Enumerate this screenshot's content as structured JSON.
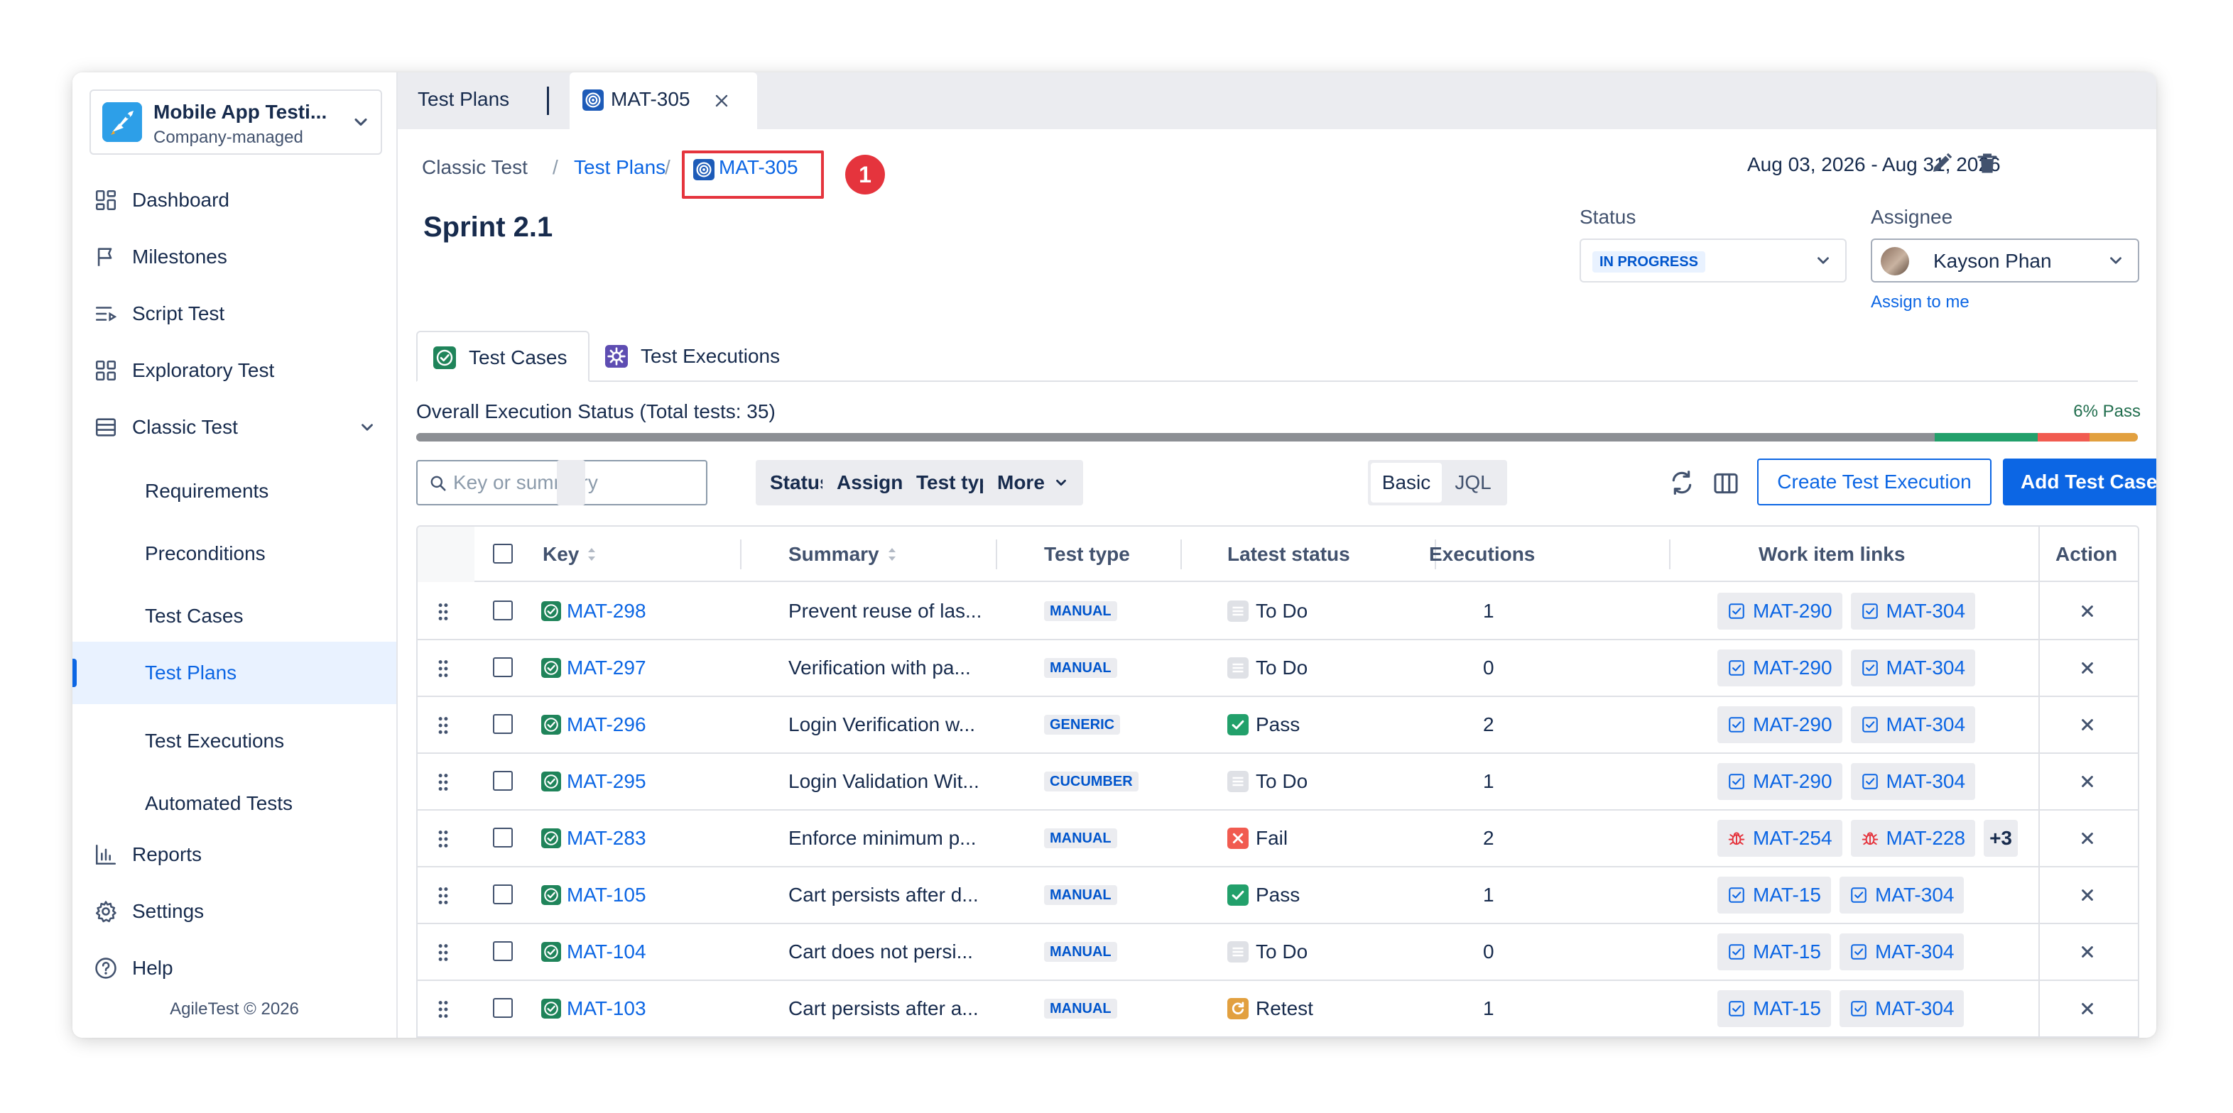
{
  "sidebar": {
    "project_name": "Mobile App Testi...",
    "project_type": "Company-managed",
    "items": [
      {
        "label": "Dashboard",
        "icon": "dashboard-icon"
      },
      {
        "label": "Milestones",
        "icon": "flag-icon"
      },
      {
        "label": "Script Test",
        "icon": "script-list-icon"
      },
      {
        "label": "Exploratory Test",
        "icon": "grid-icon"
      },
      {
        "label": "Classic Test",
        "icon": "table-icon"
      },
      {
        "label": "Requirements"
      },
      {
        "label": "Preconditions"
      },
      {
        "label": "Test Cases"
      },
      {
        "label": "Test Plans",
        "active": true
      },
      {
        "label": "Test Executions"
      },
      {
        "label": "Automated Tests"
      },
      {
        "label": "Reports",
        "icon": "bar-chart-icon"
      },
      {
        "label": "Settings",
        "icon": "gear-icon"
      },
      {
        "label": "Help",
        "icon": "help-icon"
      }
    ],
    "footer": "AgileTest © 2026"
  },
  "tabs": {
    "first": "Test Plans",
    "active": "MAT-305"
  },
  "breadcrumb": {
    "root": "Classic Test",
    "sep": "/",
    "section": "Test Plans",
    "current": "MAT-305",
    "annotation_number": "1"
  },
  "plan": {
    "title": "Sprint 2.1",
    "date_range": "Aug 03, 2026 - Aug 31, 2026",
    "status_label": "Status",
    "status_value": "IN PROGRESS",
    "assignee_label": "Assignee",
    "assignee_value": "Kayson Phan",
    "assign_to_me": "Assign to me"
  },
  "content_tabs": {
    "cases": "Test Cases",
    "executions": "Test Executions"
  },
  "execution_status": {
    "label": "Overall Execution Status (Total tests: 35)",
    "pass_text": "6% Pass",
    "segments": [
      {
        "name": "not-run",
        "fraction": 0.882,
        "color": "#8c8f94"
      },
      {
        "name": "pass",
        "fraction": 0.06,
        "color": "#22a06b"
      },
      {
        "name": "fail",
        "fraction": 0.03,
        "color": "#f15b50"
      },
      {
        "name": "retest",
        "fraction": 0.028,
        "color": "#e2a03f"
      }
    ]
  },
  "filters": {
    "search_placeholder": "Key or summary",
    "status": "Status",
    "assignee": "Assignee",
    "test_type": "Test type",
    "more": "More",
    "basic": "Basic",
    "jql": "JQL",
    "create_execution": "Create Test Execution",
    "add_test_cases": "Add Test Cases"
  },
  "table": {
    "columns": {
      "key": "Key",
      "summary": "Summary",
      "test_type": "Test type",
      "latest_status": "Latest status",
      "executions": "Executions",
      "links": "Work item links",
      "action": "Action"
    },
    "rows": [
      {
        "key": "MAT-298",
        "summary": "Prevent reuse of las...",
        "type": "MANUAL",
        "status": "To Do",
        "status_kind": "todo",
        "executions": "1",
        "links": [
          {
            "key": "MAT-290",
            "kind": "story"
          },
          {
            "key": "MAT-304",
            "kind": "story"
          }
        ],
        "more": ""
      },
      {
        "key": "MAT-297",
        "summary": "Verification with pa...",
        "type": "MANUAL",
        "status": "To Do",
        "status_kind": "todo",
        "executions": "0",
        "links": [
          {
            "key": "MAT-290",
            "kind": "story"
          },
          {
            "key": "MAT-304",
            "kind": "story"
          }
        ],
        "more": ""
      },
      {
        "key": "MAT-296",
        "summary": "Login Verification w...",
        "type": "GENERIC",
        "status": "Pass",
        "status_kind": "pass",
        "executions": "2",
        "links": [
          {
            "key": "MAT-290",
            "kind": "story"
          },
          {
            "key": "MAT-304",
            "kind": "story"
          }
        ],
        "more": ""
      },
      {
        "key": "MAT-295",
        "summary": "Login Validation Wit...",
        "type": "CUCUMBER",
        "status": "To Do",
        "status_kind": "todo",
        "executions": "1",
        "links": [
          {
            "key": "MAT-290",
            "kind": "story"
          },
          {
            "key": "MAT-304",
            "kind": "story"
          }
        ],
        "more": ""
      },
      {
        "key": "MAT-283",
        "summary": "Enforce minimum p...",
        "type": "MANUAL",
        "status": "Fail",
        "status_kind": "fail",
        "executions": "2",
        "links": [
          {
            "key": "MAT-254",
            "kind": "bug"
          },
          {
            "key": "MAT-228",
            "kind": "bug"
          }
        ],
        "more": "+3"
      },
      {
        "key": "MAT-105",
        "summary": "Cart persists after d...",
        "type": "MANUAL",
        "status": "Pass",
        "status_kind": "pass",
        "executions": "1",
        "links": [
          {
            "key": "MAT-15",
            "kind": "story"
          },
          {
            "key": "MAT-304",
            "kind": "story"
          }
        ],
        "more": ""
      },
      {
        "key": "MAT-104",
        "summary": "Cart does not persi...",
        "type": "MANUAL",
        "status": "To Do",
        "status_kind": "todo",
        "executions": "0",
        "links": [
          {
            "key": "MAT-15",
            "kind": "story"
          },
          {
            "key": "MAT-304",
            "kind": "story"
          }
        ],
        "more": ""
      },
      {
        "key": "MAT-103",
        "summary": "Cart persists after a...",
        "type": "MANUAL",
        "status": "Retest",
        "status_kind": "retest",
        "executions": "1",
        "links": [
          {
            "key": "MAT-15",
            "kind": "story"
          },
          {
            "key": "MAT-304",
            "kind": "story"
          }
        ],
        "more": ""
      }
    ]
  }
}
